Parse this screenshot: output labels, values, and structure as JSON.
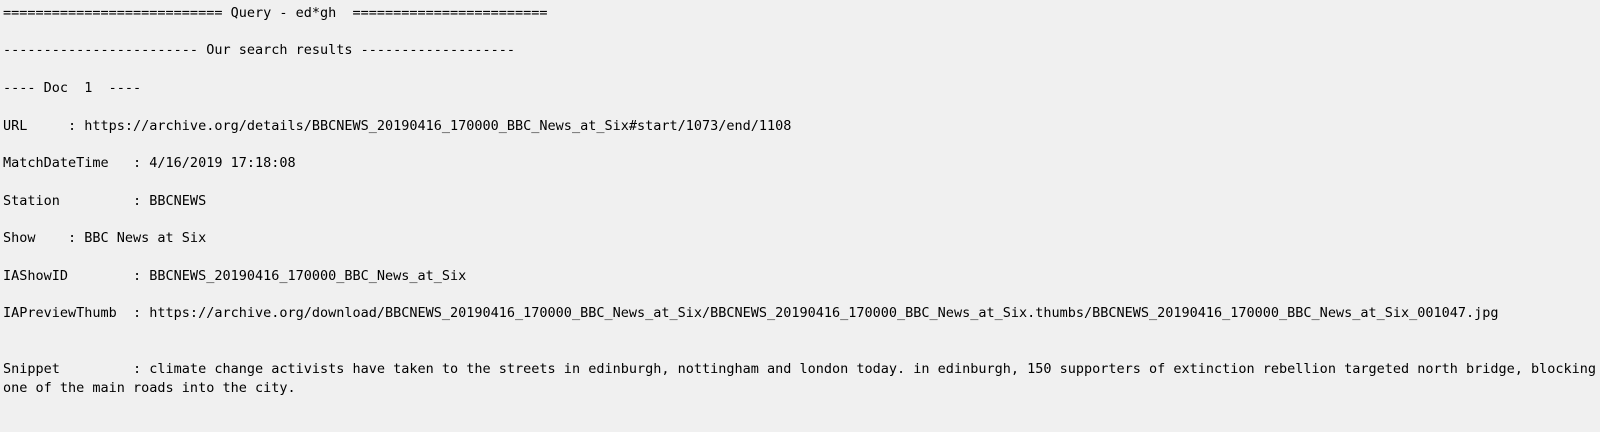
{
  "query_header": "=========================== Query - ed*gh  ========================",
  "results_header": "------------------------ Our search results -------------------",
  "doc_header": "---- Doc  1  ----",
  "fields": {
    "url": "URL     : https://archive.org/details/BBCNEWS_20190416_170000_BBC_News_at_Six#start/1073/end/1108",
    "match_datetime": "MatchDateTime   : 4/16/2019 17:18:08",
    "station": "Station         : BBCNEWS",
    "show": "Show    : BBC News at Six",
    "ia_show_id": "IAShowID        : BBCNEWS_20190416_170000_BBC_News_at_Six",
    "ia_preview_thumb": "IAPreviewThumb  : https://archive.org/download/BBCNEWS_20190416_170000_BBC_News_at_Six/BBCNEWS_20190416_170000_BBC_News_at_Six.thumbs/BBCNEWS_20190416_170000_BBC_News_at_Six_001047.jpg",
    "snippet": "Snippet         : climate change activists have taken to the streets in edinburgh, nottingham and london today. in edinburgh, 150 supporters of extinction rebellion targeted north bridge, blocking one of the main roads into the city."
  }
}
